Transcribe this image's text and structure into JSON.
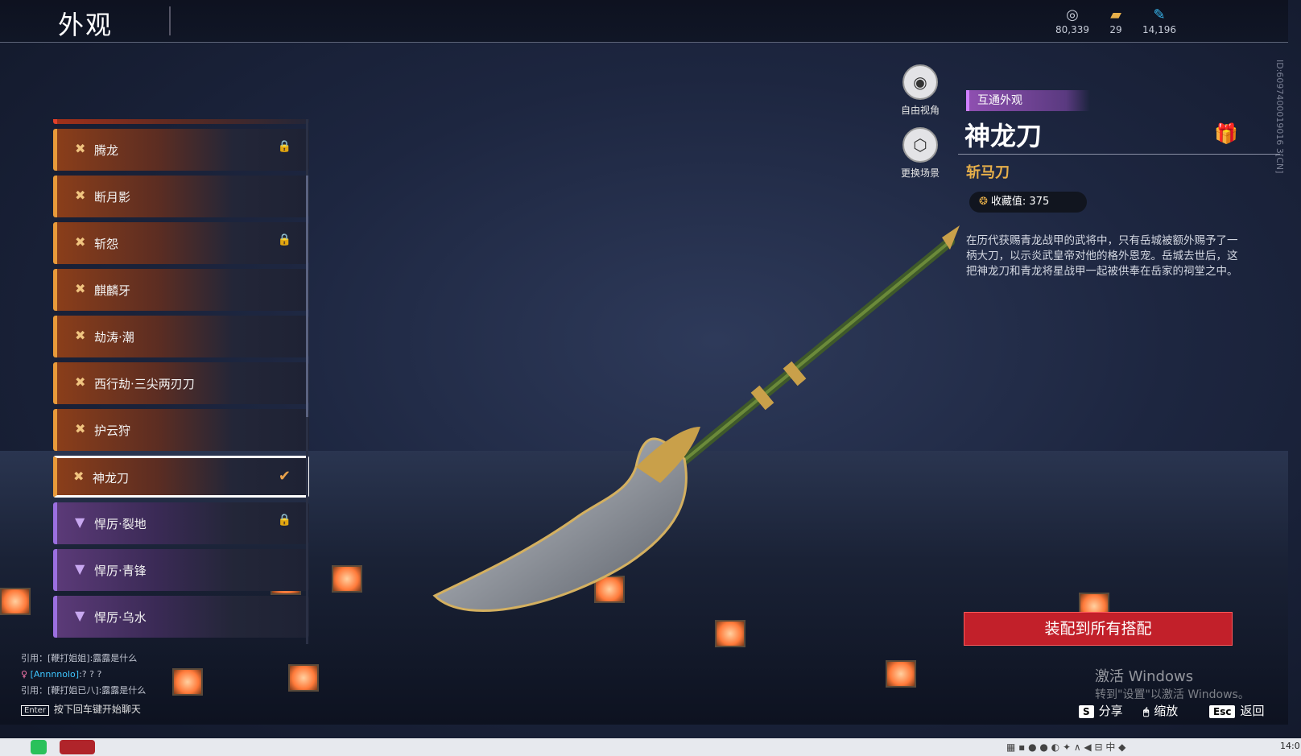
{
  "header": {
    "title": "外观"
  },
  "currencies": [
    {
      "icon": "silver-coin-icon",
      "value": "80,339"
    },
    {
      "icon": "ticket-icon",
      "value": "29"
    },
    {
      "icon": "feather-icon",
      "value": "14,196"
    }
  ],
  "list": {
    "items": [
      {
        "label": "腾龙",
        "rarity": "orange",
        "locked": true,
        "selected": false
      },
      {
        "label": "断月影",
        "rarity": "orange",
        "locked": false,
        "selected": false
      },
      {
        "label": "斩怨",
        "rarity": "orange",
        "locked": true,
        "selected": false
      },
      {
        "label": "麒麟牙",
        "rarity": "orange",
        "locked": false,
        "selected": false
      },
      {
        "label": "劫涛·潮",
        "rarity": "orange",
        "locked": false,
        "selected": false
      },
      {
        "label": "西行劫·三尖两刃刀",
        "rarity": "orange",
        "locked": false,
        "selected": false
      },
      {
        "label": "护云狩",
        "rarity": "orange",
        "locked": false,
        "selected": false
      },
      {
        "label": "神龙刀",
        "rarity": "orange",
        "locked": false,
        "selected": true
      },
      {
        "label": "悍厉·裂地",
        "rarity": "purple",
        "locked": true,
        "selected": false
      },
      {
        "label": "悍厉·青锋",
        "rarity": "purple",
        "locked": false,
        "selected": false
      },
      {
        "label": "悍厉·乌水",
        "rarity": "purple",
        "locked": false,
        "selected": false
      }
    ]
  },
  "side_buttons": {
    "free_camera": "自由视角",
    "change_scene": "更换场景"
  },
  "detail": {
    "tag": "互通外观",
    "name": "神龙刀",
    "type": "斩马刀",
    "collect_label": "收藏值: 375",
    "description": "在历代获赐青龙战甲的武将中，只有岳城被额外赐予了一柄大刀，以示炎武皇帝对他的格外恩宠。岳城去世后，这把神龙刀和青龙将星战甲一起被供奉在岳家的祠堂之中。",
    "vertical_id": "ID:6097400019016 3[CN]"
  },
  "equip_button": "装配到所有搭配",
  "watermark": {
    "line1": "激活 Windows",
    "line2": "转到\"设置\"以激活 Windows。"
  },
  "hotkeys": {
    "share_key": "S",
    "share_label": "分享",
    "zoom_key": "🖱",
    "zoom_label": "缩放",
    "back_key": "Esc",
    "back_label": "返回"
  },
  "chat": {
    "line1": "引用：[鞭打姐姐]:露露是什么",
    "line2_name": "[Annnnolo]",
    "line2_text": ":? ? ?",
    "line3": "引用：[鞭打姐已八]:露露是什么",
    "hint_key": "Enter",
    "hint": "按下回车键开始聊天"
  },
  "taskbar": {
    "clock": "14:0"
  },
  "colors": {
    "accent_orange": "#e89a3a",
    "accent_purple": "#9b6fe0",
    "equip_red": "#c2202a",
    "type_gold": "#e8b04a"
  }
}
